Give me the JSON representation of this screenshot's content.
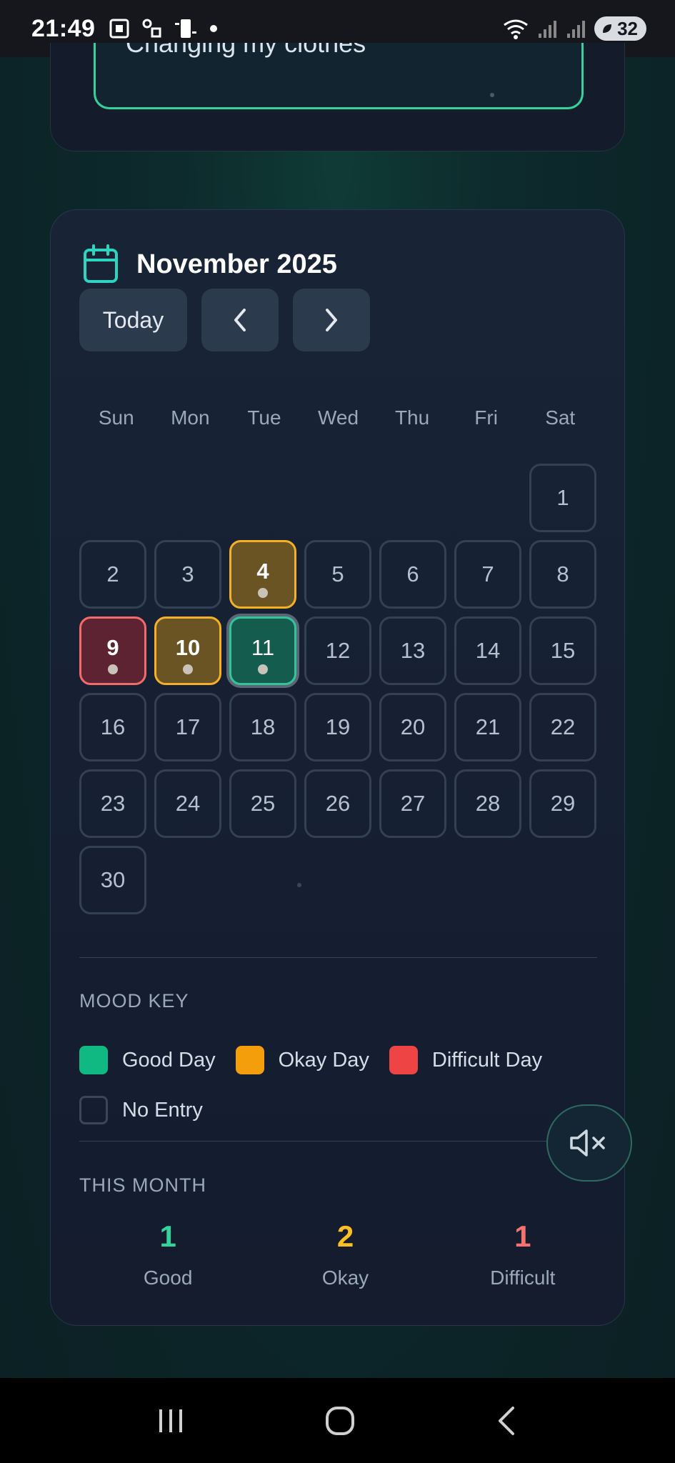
{
  "status_bar": {
    "time": "21:49",
    "battery": "32"
  },
  "top_card": {
    "entry_text": "Changing my clothes"
  },
  "calendar": {
    "month_title": "November 2025",
    "today_label": "Today",
    "weekdays": [
      "Sun",
      "Mon",
      "Tue",
      "Wed",
      "Thu",
      "Fri",
      "Sat"
    ],
    "days": [
      {
        "n": "1",
        "mood": "none"
      },
      {
        "n": "2",
        "mood": "none"
      },
      {
        "n": "3",
        "mood": "none"
      },
      {
        "n": "4",
        "mood": "okay"
      },
      {
        "n": "5",
        "mood": "none"
      },
      {
        "n": "6",
        "mood": "none"
      },
      {
        "n": "7",
        "mood": "none"
      },
      {
        "n": "8",
        "mood": "none"
      },
      {
        "n": "9",
        "mood": "difficult"
      },
      {
        "n": "10",
        "mood": "okay"
      },
      {
        "n": "11",
        "mood": "good",
        "selected": true
      },
      {
        "n": "12",
        "mood": "none"
      },
      {
        "n": "13",
        "mood": "none"
      },
      {
        "n": "14",
        "mood": "none"
      },
      {
        "n": "15",
        "mood": "none"
      },
      {
        "n": "16",
        "mood": "none"
      },
      {
        "n": "17",
        "mood": "none"
      },
      {
        "n": "18",
        "mood": "none"
      },
      {
        "n": "19",
        "mood": "none"
      },
      {
        "n": "20",
        "mood": "none"
      },
      {
        "n": "21",
        "mood": "none"
      },
      {
        "n": "22",
        "mood": "none"
      },
      {
        "n": "23",
        "mood": "none"
      },
      {
        "n": "24",
        "mood": "none"
      },
      {
        "n": "25",
        "mood": "none"
      },
      {
        "n": "26",
        "mood": "none"
      },
      {
        "n": "27",
        "mood": "none"
      },
      {
        "n": "28",
        "mood": "none"
      },
      {
        "n": "29",
        "mood": "none"
      },
      {
        "n": "30",
        "mood": "none"
      }
    ]
  },
  "mood_key": {
    "heading": "MOOD KEY",
    "items": [
      {
        "label": "Good Day",
        "color": "#10b981"
      },
      {
        "label": "Okay Day",
        "color": "#f59e0b"
      },
      {
        "label": "Difficult Day",
        "color": "#ef4444"
      },
      {
        "label": "No Entry",
        "color": "none"
      }
    ]
  },
  "this_month": {
    "heading": "THIS MONTH",
    "stats": [
      {
        "value": "1",
        "label": "Good",
        "color": "#34d399"
      },
      {
        "value": "2",
        "label": "Okay",
        "color": "#fbbf24"
      },
      {
        "value": "1",
        "label": "Difficult",
        "color": "#f87171"
      }
    ]
  },
  "icons": {
    "calendar": "calendar-icon",
    "prev": "chevron-left-icon",
    "next": "chevron-right-icon",
    "mute": "speaker-muted-icon"
  }
}
